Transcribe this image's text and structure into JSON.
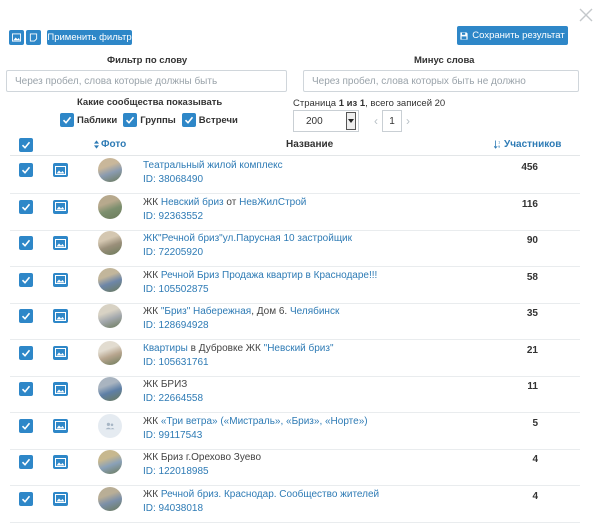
{
  "toolbar": {
    "apply_filter": "Применить фильтр",
    "save_result": "Сохранить результат"
  },
  "filters": {
    "word_label": "Фильтр по слову",
    "word_placeholder": "Через пробел, слова которые должны быть",
    "minus_label": "Минус слова",
    "minus_placeholder": "Через пробел, слова которых быть не должно",
    "show_label": "Какие сообщества показывать",
    "types": [
      {
        "label": "Паблики",
        "checked": true
      },
      {
        "label": "Группы",
        "checked": true
      },
      {
        "label": "Встречи",
        "checked": true
      }
    ]
  },
  "pagination": {
    "prefix": "Страница ",
    "current": "1",
    "of_word": " из ",
    "total_pages": "1",
    "records_text": ", всего записей 20",
    "per_page": "200",
    "page_input": "1"
  },
  "table": {
    "col_photo": "Фото",
    "col_name": "Название",
    "col_members": "Участников"
  },
  "rows": [
    {
      "parts": [
        {
          "t": "Театральный жилой комплекс",
          "link": true
        }
      ],
      "id": "ID: 38068490",
      "members": "456"
    },
    {
      "parts": [
        {
          "t": "ЖК ",
          "link": false
        },
        {
          "t": "Невский бриз",
          "link": true
        },
        {
          "t": " от ",
          "link": false
        },
        {
          "t": "НевЖилСтрой",
          "link": true
        }
      ],
      "id": "ID: 92363552",
      "members": "116"
    },
    {
      "parts": [
        {
          "t": "ЖК\"Речной бриз\"ул.Парусная 10 застройщик",
          "link": true
        }
      ],
      "id": "ID: 72205920",
      "members": "90"
    },
    {
      "parts": [
        {
          "t": "ЖК ",
          "link": false
        },
        {
          "t": "Речной Бриз Продажа квартир в Краснодаре!!!",
          "link": true
        }
      ],
      "id": "ID: 105502875",
      "members": "58"
    },
    {
      "parts": [
        {
          "t": "ЖК ",
          "link": false
        },
        {
          "t": "\"Бриз\" Набережная",
          "link": true
        },
        {
          "t": ", Дом 6. ",
          "link": false
        },
        {
          "t": "Челябинск",
          "link": true
        }
      ],
      "id": "ID: 128694928",
      "members": "35"
    },
    {
      "parts": [
        {
          "t": "Квартиры",
          "link": true
        },
        {
          "t": " в Дубровке ЖК ",
          "link": false
        },
        {
          "t": "\"Невский бриз\"",
          "link": true
        }
      ],
      "id": "ID: 105631761",
      "members": "21"
    },
    {
      "parts": [
        {
          "t": "ЖК БРИЗ",
          "link": false
        }
      ],
      "id": "ID: 22664558",
      "members": "11"
    },
    {
      "parts": [
        {
          "t": "ЖК ",
          "link": false
        },
        {
          "t": "«Три ветра» («Мистраль», «Бриз», «Норте»)",
          "link": true
        }
      ],
      "id": "ID: 99117543",
      "members": "5"
    },
    {
      "parts": [
        {
          "t": "ЖК Бриз г.Орехово Зуево",
          "link": false
        }
      ],
      "id": "ID: 122018985",
      "members": "4"
    },
    {
      "parts": [
        {
          "t": "ЖК ",
          "link": false
        },
        {
          "t": "Речной бриз. Краснодар. Сообщество жителей",
          "link": true
        }
      ],
      "id": "ID: 94038018",
      "members": "4"
    }
  ],
  "colors": {
    "accent": "#2e87c8",
    "link": "#2e7bb5"
  }
}
